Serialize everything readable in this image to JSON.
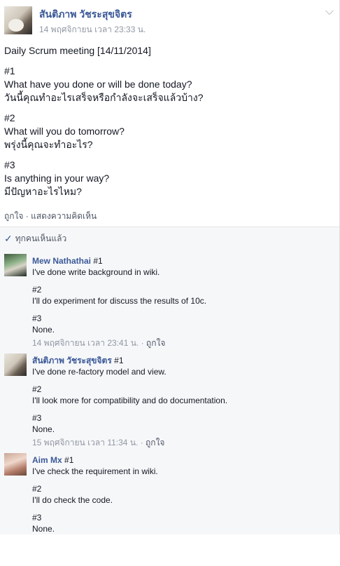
{
  "post": {
    "author": "สันติภาพ วัชระสุขจิตร",
    "time": "14 พฤศจิกายน เวลา 23:33 น.",
    "lines": {
      "title": "Daily Scrum meeting [14/11/2014]",
      "q1_num": "#1",
      "q1_en": "What have you done or will be done today?",
      "q1_th": "วันนี้คุณทำอะไรเสร็จหรือกำลังจะเสร็จแล้วบ้าง?",
      "q2_num": "#2",
      "q2_en": "What will you do tomorrow?",
      "q2_th": "พรุ่งนี้คุณจะทำอะไร?",
      "q3_num": "#3",
      "q3_en": "Is anything in your way?",
      "q3_th": "มีปัญหาอะไรไหม?"
    },
    "actions": {
      "like": "ถูกใจ",
      "separator": " · ",
      "comment": "แสดงความคิดเห็น"
    }
  },
  "seen": {
    "label": "ทุกคนเห็นแล้ว"
  },
  "comments": [
    {
      "name": "Mew Nathathai",
      "first": "#1",
      "line1": "I've done write background in wiki.",
      "q2": "#2",
      "line2": "I'll do experiment for discuss the results of 10c.",
      "q3": "#3",
      "line3": "None.",
      "time": "14 พฤศจิกายน เวลา 23:41 น.",
      "like": "ถูกใจ"
    },
    {
      "name": "สันติภาพ วัชระสุขจิตร",
      "first": "#1",
      "line1": "I've done re-factory model and view.",
      "q2": "#2",
      "line2": "I'll look more for compatibility and do documentation.",
      "q3": "#3",
      "line3": "None.",
      "time": "15 พฤศจิกายน เวลา 11:34 น.",
      "like": "ถูกใจ"
    },
    {
      "name": "Aim Mx",
      "first": "#1",
      "line1": "I've check the requirement in wiki.",
      "q2": "#2",
      "line2": "I'll do check the code.",
      "q3": "#3",
      "line3": "None."
    }
  ],
  "icons": {
    "chevron": "chevron-down-icon",
    "check": "check-icon"
  },
  "colors": {
    "link": "#3b5998",
    "meta": "#9197a3",
    "comment_bg": "#f6f7f9"
  }
}
